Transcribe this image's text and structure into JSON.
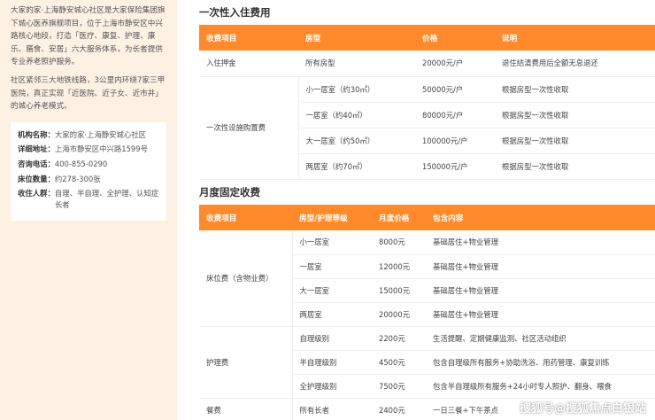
{
  "sidebar": {
    "intro1": "大家的家·上海静安城心社区是大家保险集团旗下城心医养旗舰项目，位于上海市静安区中兴路核心地段，打造「医疗、康复、护理、康乐、膳食、安居」六大服务体系，为长者提供专业养老照护服务。",
    "intro2": "社区紧邻三大地铁线路，3公里内环绕7家三甲医院，真正实现「近医院、近子女、近市井」的城心养老模式。",
    "info": [
      {
        "label": "机构名称：",
        "value": "大家的家·上海静安城心社区"
      },
      {
        "label": "详细地址：",
        "value": "上海市静安区中兴路1599号"
      },
      {
        "label": "咨询电话：",
        "value": "400-855-0290"
      },
      {
        "label": "床位数量：",
        "value": "约278-300张"
      },
      {
        "label": "收住人群：",
        "value": "自理、半自理、全护理、认知症长者"
      }
    ]
  },
  "section1": {
    "title": "一次性入住费用",
    "headers": [
      "收费项目",
      "房型",
      "价格",
      "说明"
    ],
    "deposit": {
      "item": "入住押金",
      "room": "所有房型",
      "price": "20000元/户",
      "note": "退住结清费用后全额无息退还"
    },
    "facility_label": "一次性设施购置费",
    "facility_rows": [
      {
        "room": "小一居室（约30㎡）",
        "price": "50000元/户",
        "note": "根据房型一次性收取"
      },
      {
        "room": "一居室（约40㎡）",
        "price": "80000元/户",
        "note": "根据房型一次性收取"
      },
      {
        "room": "大一居室（约50㎡）",
        "price": "100000元/户",
        "note": "根据房型一次性收取"
      },
      {
        "room": "两居室（约70㎡）",
        "price": "150000元/户",
        "note": "根据房型一次性收取"
      }
    ]
  },
  "section2": {
    "title": "月度固定收费",
    "headers": [
      "收费项目",
      "房型/护理等级",
      "月度价格",
      "包含内容"
    ],
    "bed": {
      "label": "床位费（含物业费）",
      "rows": [
        {
          "level": "小一居室",
          "price": "8000元",
          "content": "基础居住+物业管理"
        },
        {
          "level": "一居室",
          "price": "12000元",
          "content": "基础居住+物业管理"
        },
        {
          "level": "大一居室",
          "price": "15000元",
          "content": "基础居住+物业管理"
        },
        {
          "level": "两居室",
          "price": "20000元",
          "content": "基础居住+物业管理"
        }
      ]
    },
    "care": {
      "label": "护理费",
      "rows": [
        {
          "level": "自理级别",
          "price": "2200元",
          "content": "生活提醒、定期健康监测、社区活动组织"
        },
        {
          "level": "半自理级别",
          "price": "4500元",
          "content": "包含自理级所有服务+协助洗浴、用药管理、康复训练"
        },
        {
          "level": "全护理级别",
          "price": "7500元",
          "content": "包含半自理级所有服务+24小时专人照护、翻身、喂食"
        }
      ]
    },
    "meal": {
      "label": "餐费",
      "level": "所有长者",
      "price": "2400元",
      "content": "一日三餐+下午茶点"
    }
  },
  "watermark": "搜狐号@搜狐焦点白银站"
}
